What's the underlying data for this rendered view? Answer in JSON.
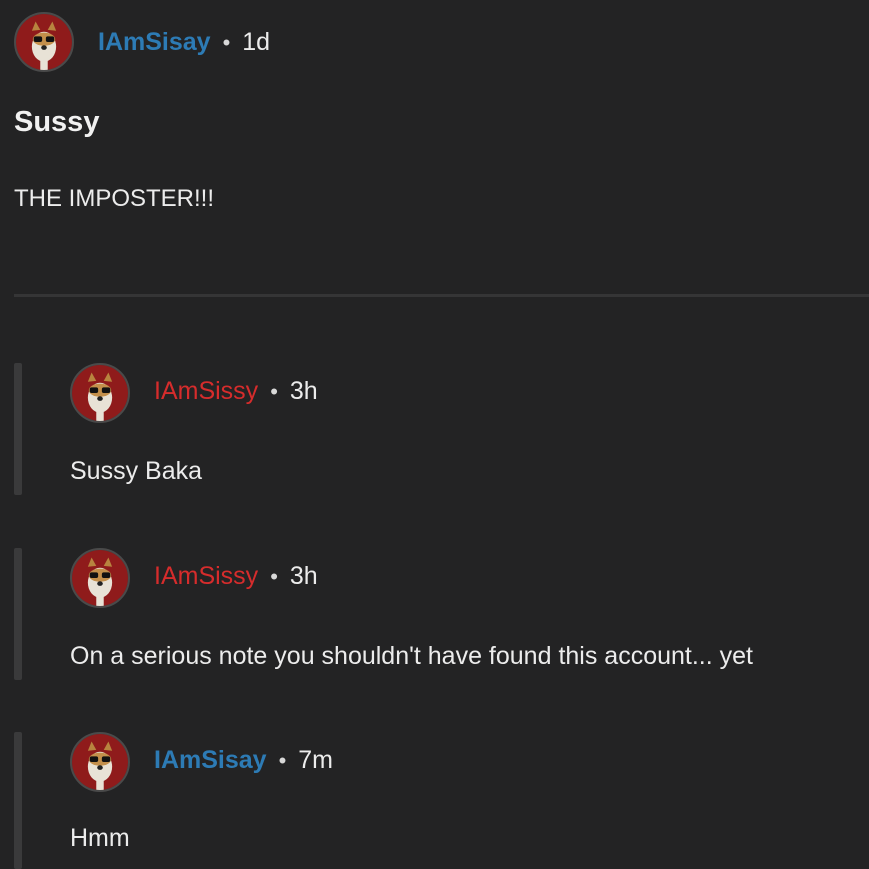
{
  "post": {
    "username": "IAmSisay",
    "separator": "•",
    "time": "1d",
    "title": "Sussy",
    "body": "THE IMPOSTER!!!"
  },
  "replies": [
    {
      "username": "IAmSissy",
      "username_color": "red",
      "separator": "•",
      "time": "3h",
      "text": "Sussy Baka"
    },
    {
      "username": "IAmSissy",
      "username_color": "red",
      "separator": "•",
      "time": "3h",
      "text": "On a serious note you shouldn't have found this account... yet"
    },
    {
      "username": "IAmSisay",
      "username_color": "blue",
      "separator": "•",
      "time": "7m",
      "text": "Hmm"
    }
  ],
  "colors": {
    "background": "#232324",
    "username_blue": "#2d7bb5",
    "username_red": "#d62c2c",
    "avatar_red": "#9b1c1c"
  }
}
